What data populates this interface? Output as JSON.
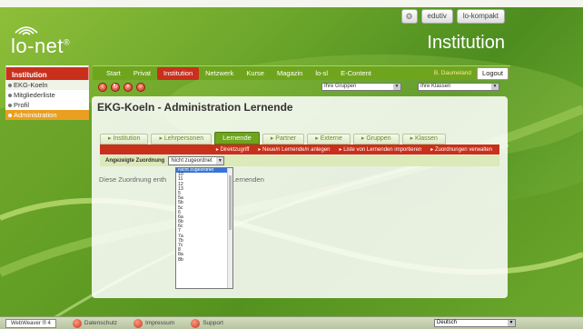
{
  "header": {
    "logo_text": "lo-net",
    "logo_reg": "®",
    "section_title": "Institution",
    "toplinks": [
      "edutiv",
      "lo-kompakt"
    ]
  },
  "sidebar": {
    "title": "Institution",
    "items": [
      {
        "label": "EKG-Koeln"
      },
      {
        "label": "Mitgliederliste"
      },
      {
        "label": "Profil"
      },
      {
        "label": "Administration"
      }
    ]
  },
  "mainnav": {
    "items": [
      "Start",
      "Privat",
      "Institution",
      "Netzwerk",
      "Kurse",
      "Magazin",
      "lo-sl",
      "E-Content"
    ],
    "active": "Institution",
    "user": "B. Daumeland",
    "logout": "Logout"
  },
  "subnav": {
    "groups_select": "Ihre Gruppen",
    "classes_select": "Ihre Klassen"
  },
  "panel": {
    "title": "EKG-Koeln - Administration Lernende",
    "tabs": [
      "Institution",
      "Lehrpersonen",
      "Lernende",
      "Partner",
      "Externe",
      "Gruppen",
      "Klassen"
    ],
    "active_tab": "Lernende",
    "actions": [
      "Direktzugriff",
      "Neue/n Lernende/n anlegen",
      "Liste von Lernenden importieren",
      "Zuordnungen verwalten"
    ],
    "filter_label": "Angezeigte Zuordnung",
    "filter_value": "Nicht zugeordnet",
    "info_left": "Diese Zuordnung enth",
    "info_right": "Lernenden"
  },
  "dropdown": {
    "options": [
      "Nicht zugeordnet",
      "10",
      "11",
      "12",
      "13",
      "5",
      "5a",
      "5b",
      "5c",
      "6",
      "6a",
      "6b",
      "6c",
      "7",
      "7a",
      "7b",
      "7c",
      "8",
      "8a",
      "8b"
    ],
    "selected": "Nicht zugeordnet"
  },
  "footer": {
    "webweaver": "WebWeaver ® 4",
    "links": [
      "Datenschutz",
      "Impressum",
      "Support"
    ],
    "language": "Deutsch"
  }
}
